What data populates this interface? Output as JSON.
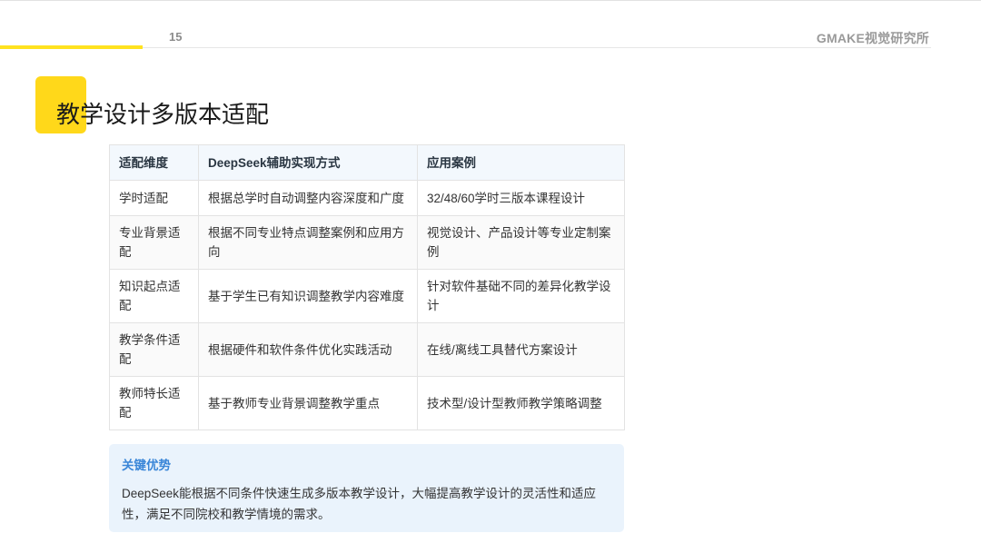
{
  "header": {
    "page_number": "15",
    "brand": "GMAKE视觉研究所"
  },
  "title": "教学设计多版本适配",
  "table": {
    "headers": [
      "适配维度",
      "DeepSeek辅助实现方式",
      "应用案例"
    ],
    "rows": [
      [
        "学时适配",
        "根据总学时自动调整内容深度和广度",
        "32/48/60学时三版本课程设计"
      ],
      [
        "专业背景适配",
        "根据不同专业特点调整案例和应用方向",
        "视觉设计、产品设计等专业定制案例"
      ],
      [
        "知识起点适配",
        "基于学生已有知识调整教学内容难度",
        "针对软件基础不同的差异化教学设计"
      ],
      [
        "教学条件适配",
        "根据硬件和软件条件优化实践活动",
        "在线/离线工具替代方案设计"
      ],
      [
        "教师特长适配",
        "基于教师专业背景调整教学重点",
        "技术型/设计型教师教学策略调整"
      ]
    ]
  },
  "advantage": {
    "title": "关键优势",
    "text": "DeepSeek能根据不同条件快速生成多版本教学设计，大幅提高教学设计的灵活性和适应性，满足不同院校和教学情境的需求。"
  },
  "colors": {
    "accent_yellow": "#ffd81a",
    "advantage_blue": "#3a86d8",
    "advantage_bg": "#eaf3fc"
  }
}
